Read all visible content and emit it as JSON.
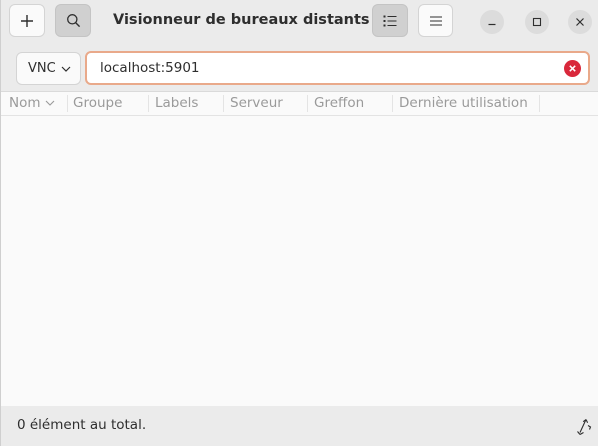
{
  "window": {
    "title": "Visionneur de bureaux distants ..."
  },
  "headerbar": {
    "add_icon": "plus-icon",
    "search_icon": "search-icon",
    "view_icon": "list-view-icon",
    "menu_icon": "hamburger-menu-icon"
  },
  "window_controls": {
    "minimize_icon": "minimize-icon",
    "maximize_icon": "maximize-icon",
    "close_icon": "close-icon"
  },
  "connection": {
    "protocol": "VNC",
    "address_value": "localhost:5901",
    "clear_icon": "clear-icon"
  },
  "columns": {
    "nom": "Nom",
    "groupe": "Groupe",
    "labels": "Labels",
    "serveur": "Serveur",
    "greffon": "Greffon",
    "derniere": "Dernière utilisation"
  },
  "status": {
    "text": "0 élément au total."
  },
  "colors": {
    "headerbar_bg": "#ebebeb",
    "content_bg": "#fafafa",
    "focus_border": "#e9a98a",
    "clear_button": "#d9283b"
  }
}
